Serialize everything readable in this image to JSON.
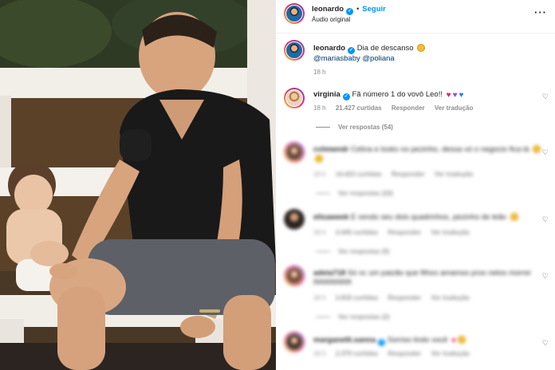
{
  "post": {
    "author": "leonardo",
    "follow_label": "Seguir",
    "audio_label": "Áudio original",
    "more_label": "···",
    "caption_author": "leonardo",
    "caption_text": "Dia de descanso",
    "caption_mention_1": "@mariasbaby",
    "caption_mention_2": "@poliana",
    "caption_time": "18 h"
  },
  "comments": [
    {
      "user": "virginia",
      "text": "Fã número 1 do vovô Leo!!",
      "time": "18 h",
      "likes": "21.427 curtidas",
      "reply": "Responder",
      "translate": "Ver tradução",
      "replies": "Ver respostas (54)",
      "heart_label": "♡"
    },
    {
      "user": "cvlmwndr",
      "text": "Celina e looks no pezinho, dessa vó o negocio fica lá",
      "time": "16 h",
      "likes": "14.423 curtidas",
      "reply": "Responder",
      "translate": "Ver tradução",
      "replies": "Ver respostas (22)"
    },
    {
      "user": "elisaweek",
      "text": "E vendo seu dois quadrinhos, pezinho de leão",
      "time": "16 h",
      "likes": "2.045 curtidas",
      "reply": "Responder",
      "translate": "Ver tradução",
      "replies": "Ver respostas (5)"
    },
    {
      "user": "adeia718",
      "text": "Só vc um paizão que filhos amamos pros netos morrer RRRRRRR",
      "time": "16 h",
      "likes": "2.818 curtidas",
      "reply": "Responder",
      "translate": "Ver tradução",
      "replies": "Ver respostas (2)"
    },
    {
      "user": "marganetli.sanna",
      "text": "Sorriso lindo você",
      "time": "16 h",
      "likes": "2.379 curtidas",
      "reply": "Responder",
      "translate": "Ver tradução",
      "replies": ""
    }
  ],
  "colors": {
    "accent": "#0095f6",
    "text": "#262626",
    "secondary": "#8e8e8e",
    "mention": "#00376b"
  },
  "icons": {
    "verified": "verified-badge-icon",
    "more": "more-options-icon",
    "like": "heart-outline-icon"
  }
}
